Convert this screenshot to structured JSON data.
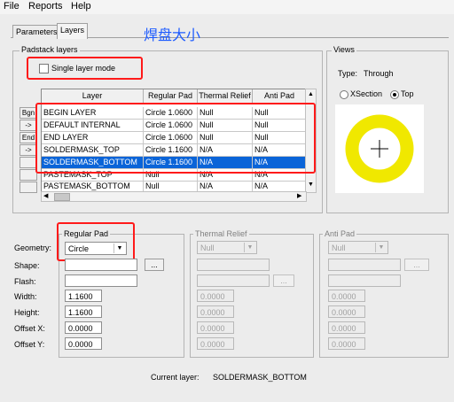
{
  "menu": [
    "File",
    "Reports",
    "Help"
  ],
  "tabs": [
    "Parameters",
    "Layers"
  ],
  "annotation": "焊盘大小",
  "padstack": {
    "title": "Padstack layers",
    "single_layer_label": "Single layer mode",
    "headers": [
      "Layer",
      "Regular Pad",
      "Thermal Relief",
      "Anti Pad"
    ],
    "rows": [
      [
        "BEGIN LAYER",
        "Circle 1.0600",
        "Null",
        "Null"
      ],
      [
        "DEFAULT INTERNAL",
        "Circle 1.0600",
        "Null",
        "Null"
      ],
      [
        "END LAYER",
        "Circle 1.0600",
        "Null",
        "Null"
      ],
      [
        "SOLDERMASK_TOP",
        "Circle 1.1600",
        "N/A",
        "N/A"
      ],
      [
        "SOLDERMASK_BOTTOM",
        "Circle 1.1600",
        "N/A",
        "N/A"
      ],
      [
        "PASTEMASK_TOP",
        "Null",
        "N/A",
        "N/A"
      ],
      [
        "PASTEMASK_BOTTOM",
        "Null",
        "N/A",
        "N/A"
      ]
    ],
    "side_buttons": [
      "Bgn",
      "->",
      "End",
      "->",
      "",
      "",
      ""
    ]
  },
  "views": {
    "title": "Views",
    "type_label": "Type:",
    "type_value": "Through",
    "xsection_label": "XSection",
    "top_label": "Top",
    "ring_color": "#f0e800"
  },
  "form": {
    "row_labels": [
      "Geometry:",
      "Shape:",
      "Flash:",
      "Width:",
      "Height:",
      "Offset X:",
      "Offset Y:"
    ],
    "regular": {
      "title": "Regular Pad",
      "geometry": "Circle",
      "width": "1.1600",
      "height": "1.1600",
      "offset_x": "0.0000",
      "offset_y": "0.0000"
    },
    "thermal": {
      "title": "Thermal Relief",
      "geometry": "Null",
      "width": "0.0000",
      "height": "0.0000",
      "offset_x": "0.0000",
      "offset_y": "0.0000"
    },
    "anti": {
      "title": "Anti Pad",
      "geometry": "Null",
      "width": "0.0000",
      "height": "0.0000",
      "offset_x": "0.0000",
      "offset_y": "0.0000"
    },
    "browse_label": "..."
  },
  "status": {
    "label": "Current layer:",
    "value": "SOLDERMASK_BOTTOM"
  },
  "colors": {
    "highlight": "#ff1a1a",
    "selection": "#0a64d8",
    "annotation": "#1e5cff"
  }
}
